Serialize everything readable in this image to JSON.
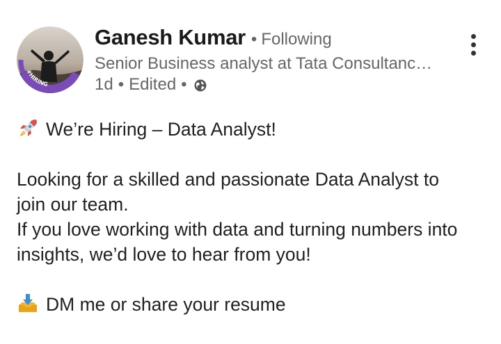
{
  "post": {
    "author": {
      "name": "Ganesh Kumar",
      "separator": "•",
      "follow_status": "Following",
      "headline": "Senior Business analyst at Tata Consultancy…",
      "time_ago": "1d",
      "edited_label": "Edited",
      "visibility_icon": "globe-icon",
      "avatar_badge": "#HIRING"
    },
    "menu_icon": "more-vertical-icon",
    "body": {
      "title_emoji": "rocket-icon",
      "title": "We’re Hiring – Data Analyst!",
      "paragraph1_line1": "Looking for a skilled and passionate Data Analyst to",
      "paragraph1_line2": "join our team.",
      "paragraph2_line1": "If you love working with data and turning numbers into",
      "paragraph2_line2": "insights, we’d love to hear from you!",
      "cta_emoji": "inbox-tray-icon",
      "cta": "DM me or share your resume"
    }
  },
  "colors": {
    "hiring_ring": "#7b4bb7",
    "muted_text": "#666666",
    "primary_text": "#1f1f1f"
  }
}
